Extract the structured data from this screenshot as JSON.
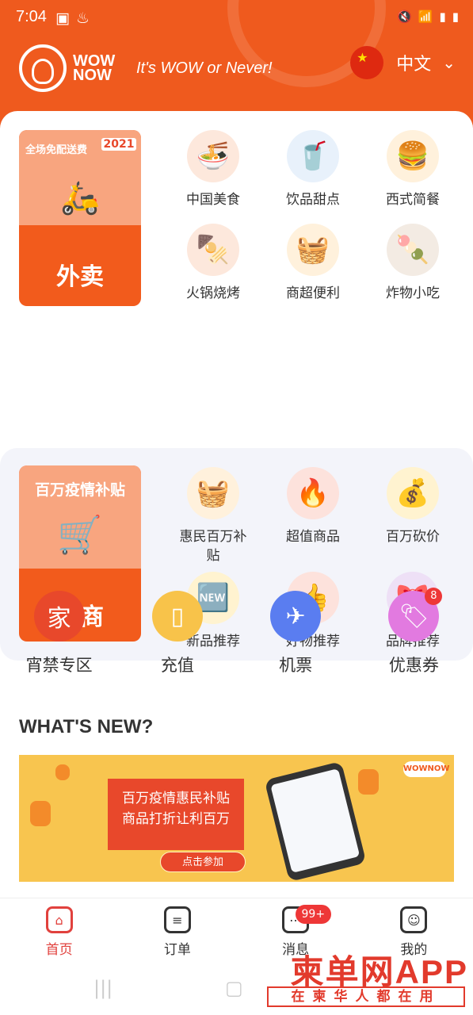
{
  "status": {
    "time": "7:04"
  },
  "header": {
    "brand": "WOW NOW",
    "slogan": "It's WOW or Never!",
    "language": "中文"
  },
  "food": {
    "banner": {
      "badge": "全场免配送费",
      "year": "2021",
      "title": "外卖"
    },
    "items": [
      {
        "label": "中国美食",
        "icon": "noodle-bowl-icon",
        "emoji": "🍜",
        "bg": "#fde8dc"
      },
      {
        "label": "饮品甜点",
        "icon": "drink-cup-icon",
        "emoji": "🥤",
        "bg": "#e8f1fb"
      },
      {
        "label": "西式简餐",
        "icon": "burger-icon",
        "emoji": "🍔",
        "bg": "#fff1dc"
      },
      {
        "label": "火锅烧烤",
        "icon": "skewer-icon",
        "emoji": "🍢",
        "bg": "#fde8dc"
      },
      {
        "label": "商超便利",
        "icon": "grocery-basket-icon",
        "emoji": "🧺",
        "bg": "#fff1dc"
      },
      {
        "label": "炸物小吃",
        "icon": "fried-snack-icon",
        "emoji": "🍡",
        "bg": "#f3ebe3"
      }
    ]
  },
  "ecommerce": {
    "banner": {
      "title": "百万疫情补贴",
      "label": "电商"
    },
    "items": [
      {
        "label": "惠民百万补贴",
        "icon": "basket-icon",
        "emoji": "🧺",
        "bg": "#fff1dc"
      },
      {
        "label": "超值商品",
        "icon": "hot-flame-icon",
        "emoji": "🔥",
        "bg": "#fde2dc"
      },
      {
        "label": "百万砍价",
        "icon": "coin-scissors-icon",
        "emoji": "💰",
        "bg": "#fff3d0"
      },
      {
        "label": "新品推荐",
        "icon": "new-badge-icon",
        "emoji": "🆕",
        "bg": "#fff3d0"
      },
      {
        "label": "好物推荐",
        "icon": "thumbs-up-icon",
        "emoji": "👍",
        "bg": "#fde2dc"
      },
      {
        "label": "品牌推荐",
        "icon": "brand-ribbon-icon",
        "emoji": "🎀",
        "bg": "#eee0f6"
      }
    ]
  },
  "quick": [
    {
      "label": "宵禁专区",
      "icon": "home-icon",
      "glyph": "家",
      "color": "#e8482b"
    },
    {
      "label": "充值",
      "icon": "phone-icon",
      "glyph": "▯",
      "color": "#f8c34a"
    },
    {
      "label": "机票",
      "icon": "airplane-icon",
      "glyph": "✈",
      "color": "#5a7df0"
    },
    {
      "label": "优惠券",
      "icon": "coupon-tag-icon",
      "glyph": "🏷",
      "color": "#e27ae0",
      "badge": "8"
    }
  ],
  "whats_new": {
    "title": "WHAT'S NEW?",
    "promo": {
      "line1": "百万疫情惠民补贴",
      "line2": "商品打折让利百万",
      "cta": "点击参加",
      "brand": "WOWNOW"
    }
  },
  "tabbar": [
    {
      "label": "首页",
      "icon": "home-tab-icon",
      "glyph": "⌂",
      "active": true
    },
    {
      "label": "订单",
      "icon": "order-list-icon",
      "glyph": "≡",
      "active": false
    },
    {
      "label": "消息",
      "icon": "message-icon",
      "glyph": "⋯",
      "active": false,
      "badge": "99+"
    },
    {
      "label": "我的",
      "icon": "profile-icon",
      "glyph": "☺",
      "active": false
    }
  ],
  "watermark": {
    "title": "柬单网APP",
    "subtitle": "在柬华人都在用"
  }
}
